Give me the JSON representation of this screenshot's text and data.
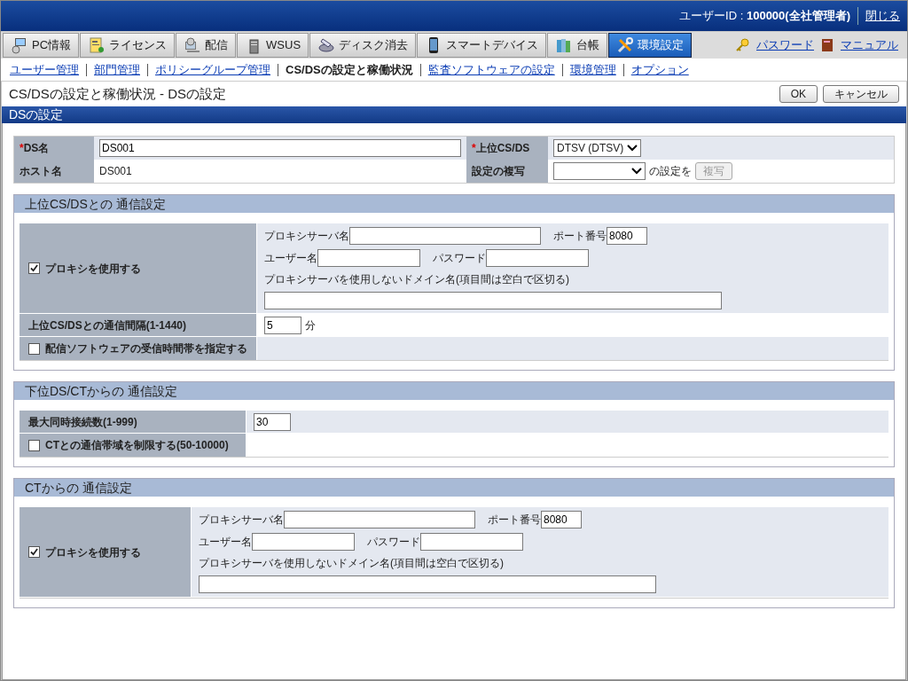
{
  "header": {
    "user_label": "ユーザーID : ",
    "user_value": "100000(全社管理者)",
    "close_link": "閉じる"
  },
  "tabs": [
    {
      "label": "PC情報",
      "selected": false
    },
    {
      "label": "ライセンス",
      "selected": false
    },
    {
      "label": "配信",
      "selected": false
    },
    {
      "label": "WSUS",
      "selected": false
    },
    {
      "label": "ディスク消去",
      "selected": false
    },
    {
      "label": "スマートデバイス",
      "selected": false
    },
    {
      "label": "台帳",
      "selected": false
    },
    {
      "label": "環境設定",
      "selected": true
    }
  ],
  "tab_links": [
    "パスワード",
    "マニュアル"
  ],
  "subnav": [
    {
      "label": "ユーザー管理",
      "selected": false
    },
    {
      "label": "部門管理",
      "selected": false
    },
    {
      "label": "ポリシーグループ管理",
      "selected": false
    },
    {
      "label": "CS/DSの設定と稼働状況",
      "selected": true
    },
    {
      "label": "監査ソフトウェアの設定",
      "selected": false
    },
    {
      "label": "環境管理",
      "selected": false
    },
    {
      "label": "オプション",
      "selected": false
    }
  ],
  "page_title": "CS/DSの設定と稼働状況 - DSの設定",
  "buttons": [
    "OK",
    "キャンセル"
  ],
  "panel_title": "DSの設定",
  "basic": {
    "ds_name": {
      "label": "DS名",
      "required_mark": "*",
      "value": "DS001"
    },
    "upper": {
      "label": "上位CS/DS",
      "required_mark": "*",
      "value": "DTSV (DTSV)"
    },
    "host": {
      "label": "ホスト名",
      "value": "DS001"
    },
    "copy": {
      "label": "設定の複写",
      "suffix": "の設定を",
      "button": "複写",
      "button_disabled": true
    }
  },
  "sections": [
    {
      "title": "上位CS/DSとの 通信設定",
      "rows": [
        {
          "kind": "proxy",
          "label": "プロキシを使用する",
          "checked": true,
          "server_label": "プロキシサーバ名",
          "server": "",
          "port_label": "ポート番号",
          "port": "8080",
          "user_label": "ユーザー名",
          "user": "",
          "password_label": "パスワード",
          "password": "",
          "exclude_label": "プロキシサーバを使用しないドメイン名(項目間は空白で区切る)",
          "exclude": ""
        },
        {
          "kind": "field",
          "label": "上位CS/DSとの通信間隔(1-1440)",
          "value": "5",
          "unit": "分"
        },
        {
          "kind": "checkbox",
          "label": "配信ソフトウェアの受信時間帯を指定する",
          "checked": false
        }
      ]
    },
    {
      "title": "下位DS/CTからの 通信設定",
      "rows": [
        {
          "kind": "field",
          "label": "最大同時接続数(1-999)",
          "value": "30"
        },
        {
          "kind": "checkbox",
          "label": "CTとの通信帯域を制限する(50-10000)",
          "checked": false
        }
      ]
    },
    {
      "title": "CTからの 通信設定",
      "rows": [
        {
          "kind": "proxy",
          "label": "プロキシを使用する",
          "checked": true,
          "server_label": "プロキシサーバ名",
          "server": "",
          "port_label": "ポート番号",
          "port": "8080",
          "user_label": "ユーザー名",
          "user": "",
          "password_label": "パスワード",
          "password": "",
          "exclude_label": "プロキシサーバを使用しないドメイン名(項目間は空白で区切る)",
          "exclude": ""
        }
      ]
    }
  ]
}
